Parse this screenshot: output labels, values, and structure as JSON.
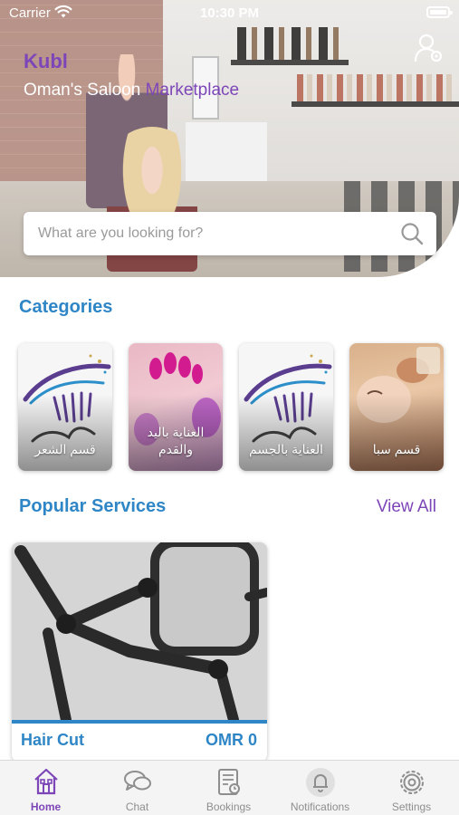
{
  "status_bar": {
    "carrier": "Carrier",
    "time": "10:30 PM"
  },
  "header": {
    "brand": "Kubl",
    "tagline_white": "Oman's Saloon ",
    "tagline_purple": "Marketplace",
    "profile_icon": "user-settings-icon"
  },
  "search": {
    "placeholder": "What are you looking for?",
    "value": "",
    "icon": "search-icon"
  },
  "categories": {
    "title": "Categories",
    "items": [
      {
        "label": "قسم الشعر",
        "image": "lash-logo"
      },
      {
        "label": "العناية باليد والقدم",
        "image": "nails-photo"
      },
      {
        "label": "العناية بالجسم",
        "image": "lash-logo"
      },
      {
        "label": "قسم سبا",
        "image": "spa-photo"
      }
    ]
  },
  "popular": {
    "title": "Popular Services",
    "view_all": "View All",
    "services": [
      {
        "name": "Hair Cut",
        "price": "OMR 0"
      }
    ]
  },
  "tabbar": {
    "tabs": [
      {
        "label": "Home",
        "icon": "home-icon",
        "active": true
      },
      {
        "label": "Chat",
        "icon": "chat-icon",
        "active": false
      },
      {
        "label": "Bookings",
        "icon": "bookings-icon",
        "active": false
      },
      {
        "label": "Notifications",
        "icon": "bell-icon",
        "active": false
      },
      {
        "label": "Settings",
        "icon": "gear-icon",
        "active": false
      }
    ]
  },
  "colors": {
    "purple": "#7d46b8",
    "blue": "#2f86c6",
    "inactive": "#8e8e8e",
    "tabbar_bg": "#f4f4f4"
  }
}
